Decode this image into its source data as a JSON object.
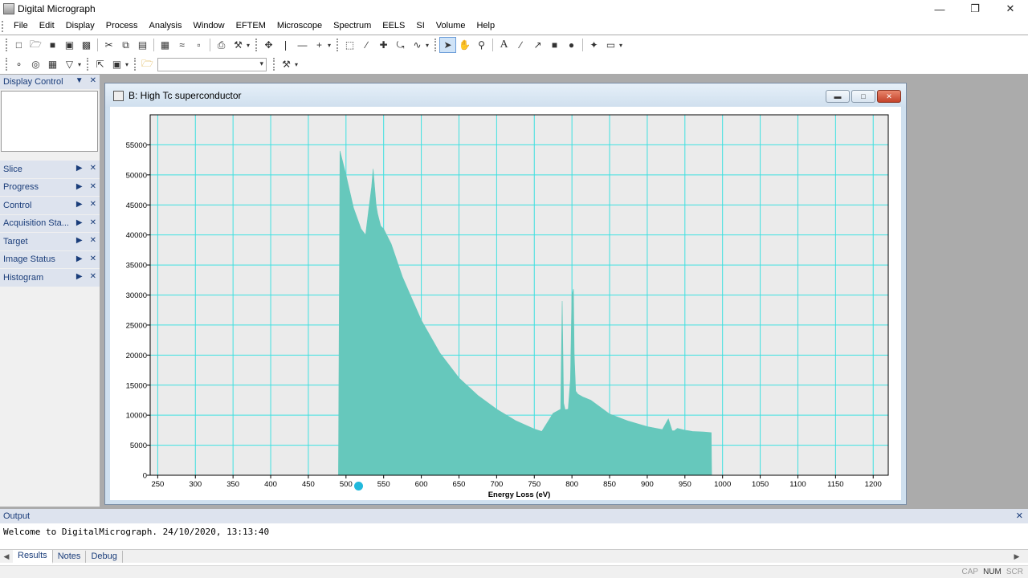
{
  "app": {
    "title": "Digital Micrograph",
    "window_controls": [
      "minimize-icon",
      "restore-icon",
      "close-icon"
    ]
  },
  "menu": [
    "File",
    "Edit",
    "Display",
    "Process",
    "Analysis",
    "Window",
    "EFTEM",
    "Microscope",
    "Spectrum",
    "EELS",
    "SI",
    "Volume",
    "Help"
  ],
  "toolbar1": {
    "icons": [
      "new-icon",
      "open-icon",
      "save-icon",
      "save-display-icon",
      "save-as-icon",
      "cut-icon",
      "copy-icon",
      "paste-icon",
      "image-display-icon",
      "line-plot-icon",
      "page-icon",
      "print-icon",
      "tools-icon",
      "move-icon",
      "vertical-line-icon",
      "horizontal-line-icon",
      "plus-icon",
      "rect-select-icon",
      "line-select-icon",
      "cross-icon",
      "lasso-icon",
      "curve-icon",
      "pointer-icon",
      "hand-icon",
      "zoom-icon",
      "text-icon",
      "line-icon",
      "arrow-line-icon",
      "rectangle-icon",
      "ellipse-icon",
      "wand-icon",
      "roi-icon"
    ]
  },
  "toolbar2": {
    "icons": [
      "point-icon",
      "circle-icon",
      "grid-icon",
      "funnel-icon",
      "select-icon",
      "camera-icon",
      "folder-icon",
      "tools-icon"
    ],
    "combo_value": ""
  },
  "left_panel": {
    "display_control": "Display Control",
    "palettes": [
      "Slice",
      "Progress",
      "Control",
      "Acquisition Sta...",
      "Target",
      "Image Status",
      "Histogram"
    ]
  },
  "image_window": {
    "title": "B: High Tc superconductor"
  },
  "chart_data": {
    "type": "area",
    "title": "",
    "xlabel": "Energy Loss (eV)",
    "ylabel": "",
    "xlim": [
      240,
      1220
    ],
    "ylim": [
      0,
      60000
    ],
    "x_ticks": [
      250,
      300,
      350,
      400,
      450,
      500,
      550,
      600,
      650,
      700,
      750,
      800,
      850,
      900,
      950,
      1000,
      1050,
      1100,
      1150,
      1200
    ],
    "y_ticks": [
      0,
      5000,
      10000,
      15000,
      20000,
      25000,
      30000,
      35000,
      40000,
      45000,
      50000,
      55000
    ],
    "grid": true,
    "series": [
      {
        "color": "#66c8bc",
        "x": [
          490,
          492,
          500,
          510,
          520,
          526,
          530,
          534,
          536,
          540,
          542,
          546,
          550,
          560,
          575,
          600,
          625,
          650,
          675,
          700,
          725,
          750,
          760,
          775,
          785,
          787,
          789,
          791,
          795,
          798,
          800,
          802,
          803,
          805,
          808,
          815,
          825,
          850,
          875,
          900,
          920,
          928,
          933,
          936,
          940,
          950,
          955,
          960,
          975,
          985,
          985.5
        ],
        "y": [
          0,
          54000,
          50000,
          44500,
          41000,
          40000,
          44000,
          48000,
          51000,
          45000,
          43500,
          41500,
          41000,
          38500,
          33000,
          25800,
          20300,
          16200,
          13300,
          11000,
          9100,
          7700,
          7300,
          10300,
          11000,
          29000,
          12000,
          10900,
          11000,
          16000,
          30000,
          31000,
          20000,
          14000,
          13500,
          13000,
          12500,
          10200,
          9000,
          8100,
          7600,
          9400,
          7400,
          7400,
          7800,
          7500,
          7400,
          7300,
          7200,
          7100,
          0
        ]
      }
    ]
  },
  "output": {
    "title": "Output",
    "text": "Welcome to DigitalMicrograph.  24/10/2020, 13:13:40",
    "tabs": [
      "Results",
      "Notes",
      "Debug"
    ]
  },
  "status": {
    "cap": "CAP",
    "num": "NUM",
    "scr": "SCR"
  }
}
